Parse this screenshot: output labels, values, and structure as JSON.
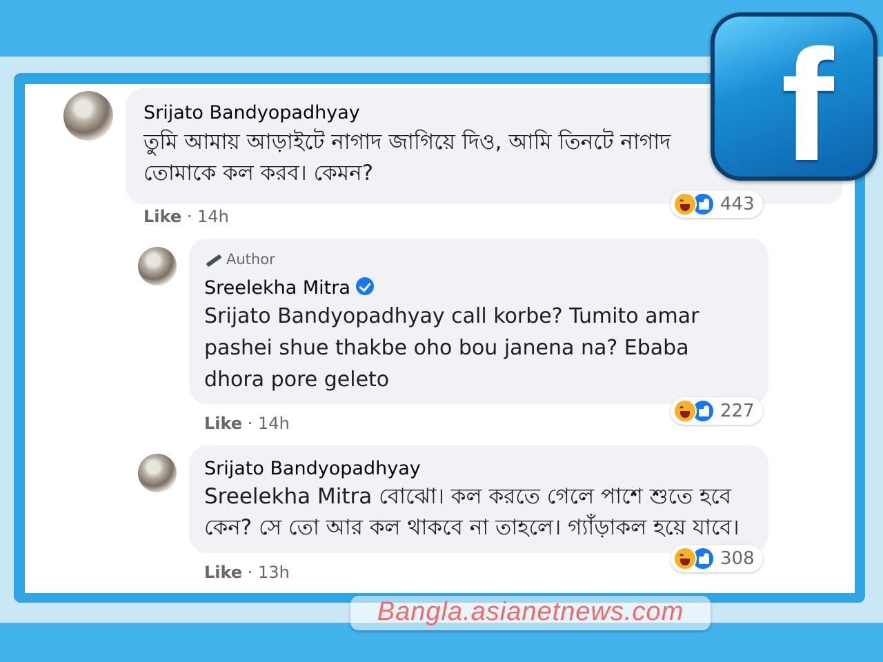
{
  "comments": [
    {
      "author": "Srijato Bandyopadhyay",
      "text": "তুমি আমায় আড়াইটে নাগাদ জাগিয়ে দিও, আমি তিনটে নাগাদ তোমাকে কল করব। কেমন?",
      "like_label": "Like",
      "time": "· 14h",
      "reaction_count": "443"
    },
    {
      "author_badge": "Author",
      "author": "Sreelekha Mitra",
      "mention": "Srijato Bandyopadhyay",
      "text": "call korbe? Tumito amar pashei shue thakbe oho bou janena na? Ebaba dhora pore geleto",
      "like_label": "Like",
      "time": "· 14h",
      "reaction_count": "227"
    },
    {
      "author": "Srijato Bandyopadhyay",
      "mention": "Sreelekha Mitra",
      "text": "বোঝো। কল করতে গেলে পাশে শুতে হবে কেন? সে তো আর কল থাকবে না তাহলে। গ্যাঁড়াকল হয়ে যাবে।",
      "like_label": "Like",
      "time": "· 13h",
      "reaction_count": "308"
    }
  ],
  "reaction_icons": [
    "haha-icon",
    "like-icon"
  ],
  "logo": {
    "letter": "f",
    "icon": "facebook-logo-icon"
  },
  "watermark": "Bangla.asianetnews.com",
  "colors": {
    "frame": "#42b3ec",
    "bubble": "#f0f2f5",
    "verified": "#1877f2"
  }
}
